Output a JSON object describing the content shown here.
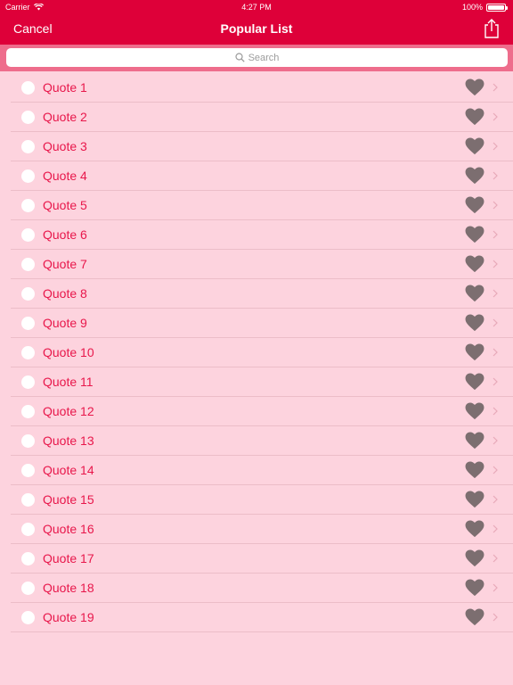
{
  "status_bar": {
    "carrier": "Carrier",
    "time": "4:27 PM",
    "battery": "100%"
  },
  "nav": {
    "cancel_label": "Cancel",
    "title": "Popular List",
    "share_icon": "share-icon"
  },
  "search": {
    "placeholder": "Search",
    "icon": "search-icon"
  },
  "list": {
    "items": [
      {
        "label": "Quote 1"
      },
      {
        "label": "Quote 2"
      },
      {
        "label": "Quote 3"
      },
      {
        "label": "Quote 4"
      },
      {
        "label": "Quote 5"
      },
      {
        "label": "Quote 6"
      },
      {
        "label": "Quote 7"
      },
      {
        "label": "Quote 8"
      },
      {
        "label": "Quote 9"
      },
      {
        "label": "Quote 10"
      },
      {
        "label": "Quote 11"
      },
      {
        "label": "Quote 12"
      },
      {
        "label": "Quote 13"
      },
      {
        "label": "Quote 14"
      },
      {
        "label": "Quote 15"
      },
      {
        "label": "Quote 16"
      },
      {
        "label": "Quote 17"
      },
      {
        "label": "Quote 18"
      },
      {
        "label": "Quote 19"
      }
    ]
  },
  "colors": {
    "header": "#de0039",
    "search_bar": "#ee6d8c",
    "background": "#fdd3de",
    "item_text": "#e8174b",
    "heart": "#7c6e70"
  }
}
